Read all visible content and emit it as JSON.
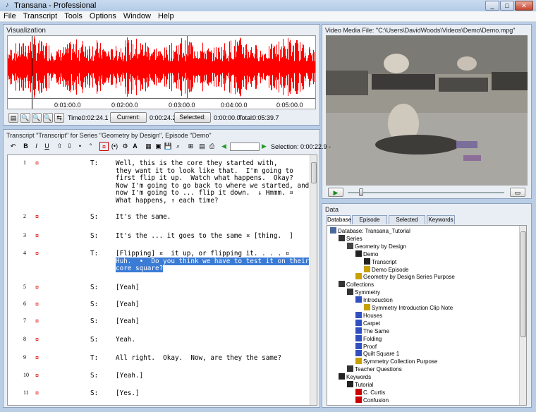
{
  "window": {
    "title": "Transana - Professional"
  },
  "menu": [
    "File",
    "Transcript",
    "Tools",
    "Options",
    "Window",
    "Help"
  ],
  "visualization": {
    "title": "Visualization",
    "time_ticks": [
      "0:01:00.0",
      "0:02:00.0",
      "0:03:00.0",
      "0:04:00.0",
      "0:05:00.0"
    ],
    "time_label": "Time:",
    "time_value": "0:02:24.1",
    "current_label": "Current:",
    "current_value": "0:00:24.2",
    "selected_label": "Selected:",
    "selected_value": "0:00:00.0",
    "total_label": "Total:",
    "total_value": "0:05:39.7",
    "waveform_color": "#ff0000"
  },
  "video": {
    "title": "Video Media File: \"C:\\Users\\DavidWoods\\Videos\\Demo\\Demo.mpg\""
  },
  "transcript": {
    "title": "Transcript \"Transcript\" for Series \"Geometry by Design\", Episode \"Demo\"",
    "selection_label": "Selection: 0:00:22.9 -",
    "lines": [
      {
        "num": "1",
        "speaker": "T:",
        "text": [
          "Well, this is the core they started with,",
          "they want it to look like that.  I'm going to",
          "first flip it up.  Watch what happens.  Okay?",
          "Now I'm going to go back to where we started, and",
          "now I'm going to ... flip it down.  ↓ Hmmm. ¤",
          "What happens, ↑ each time?"
        ]
      },
      {
        "num": "2",
        "speaker": "S:",
        "text": [
          "It's the same."
        ]
      },
      {
        "num": "3",
        "speaker": "S:",
        "text": [
          "It's the ... it goes to the same ¤ [thing.  ]"
        ]
      },
      {
        "num": "4",
        "speaker": "T:",
        "text": [
          "[Flipping] ¤  it up, or flipping it. . . . ¤ ",
          "Huh.  •  Do you think we have to test it on their",
          "core square?"
        ]
      },
      {
        "num": "5",
        "speaker": "S:",
        "text": [
          "[Yeah]"
        ]
      },
      {
        "num": "6",
        "speaker": "S:",
        "text": [
          "[Yeah]"
        ]
      },
      {
        "num": "7",
        "speaker": "S:",
        "text": [
          "[Yeah]"
        ]
      },
      {
        "num": "8",
        "speaker": "S:",
        "text": [
          "Yeah."
        ]
      },
      {
        "num": "9",
        "speaker": "T:",
        "text": [
          "All right.  Okay.  Now, are they the same?"
        ]
      },
      {
        "num": "10",
        "speaker": "S:",
        "text": [
          "[Yeah.]"
        ]
      },
      {
        "num": "11",
        "speaker": "S:",
        "text": [
          "[Yes.]"
        ]
      }
    ]
  },
  "data": {
    "title": "Data",
    "tabs": [
      "Database",
      "Episode Items",
      "Selected Items",
      "Keywords"
    ],
    "tree": [
      {
        "label": "Database: Transana_Tutorial",
        "icon": "database-icon",
        "indent": 0
      },
      {
        "label": "Series",
        "icon": "series-icon",
        "indent": 1
      },
      {
        "label": "Geometry by Design",
        "icon": "series-item-icon",
        "indent": 2
      },
      {
        "label": "Demo",
        "icon": "episode-icon",
        "indent": 3
      },
      {
        "label": "Transcript",
        "icon": "transcript-icon",
        "indent": 4
      },
      {
        "label": "Demo Episode",
        "icon": "note-icon",
        "indent": 4
      },
      {
        "label": "Geometry by Design Series Purpose",
        "icon": "note-icon",
        "indent": 3
      },
      {
        "label": "Collections",
        "icon": "collections-icon",
        "indent": 1
      },
      {
        "label": "Symmetry",
        "icon": "collection-icon",
        "indent": 2
      },
      {
        "label": "Introduction",
        "icon": "clip-icon",
        "indent": 3
      },
      {
        "label": "Symmetry Introduction Clip Note",
        "icon": "note-icon",
        "indent": 4
      },
      {
        "label": "Houses",
        "icon": "clip-icon",
        "indent": 3
      },
      {
        "label": "Carpet",
        "icon": "clip-icon",
        "indent": 3
      },
      {
        "label": "The Same",
        "icon": "clip-icon",
        "indent": 3
      },
      {
        "label": "Folding",
        "icon": "clip-icon",
        "indent": 3
      },
      {
        "label": "Proof",
        "icon": "clip-icon",
        "indent": 3
      },
      {
        "label": "Quilt Square 1",
        "icon": "clip-icon",
        "indent": 3
      },
      {
        "label": "Symmetry Collection Purpose",
        "icon": "note-icon",
        "indent": 3
      },
      {
        "label": "Teacher Questions",
        "icon": "collection-icon",
        "indent": 2
      },
      {
        "label": "Keywords",
        "icon": "keywords-icon",
        "indent": 1
      },
      {
        "label": "Tutorial",
        "icon": "keyword-group-icon",
        "indent": 2
      },
      {
        "label": "C. Curtis",
        "icon": "keyword-icon",
        "indent": 3
      },
      {
        "label": "Confusion",
        "icon": "keyword-icon",
        "indent": 3
      }
    ]
  }
}
